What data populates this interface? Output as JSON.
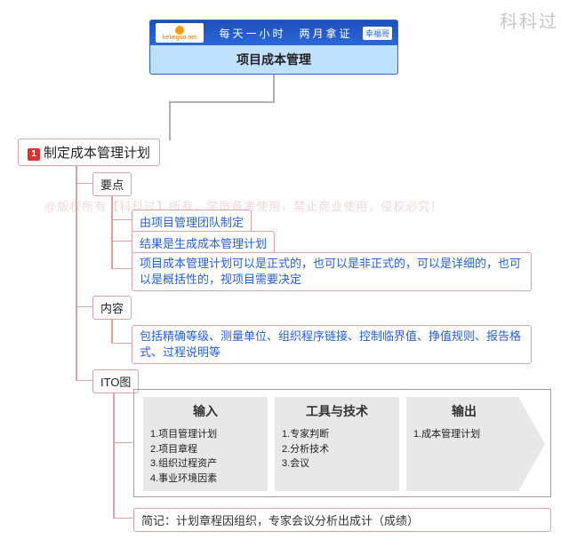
{
  "watermark": {
    "top_right": "科科过",
    "middle": "@版权所有【科科过】所有，学员备考使用，禁止商业使用，侵权必究！"
  },
  "root": {
    "brand_text": "科科过",
    "brand_url": "kekeguo.net",
    "slogan": "每天一小时　两月拿证",
    "tag": "幸福哥",
    "title": "项目成本管理"
  },
  "main_node": {
    "index": "1",
    "label": "制定成本管理计划"
  },
  "sections": {
    "keypoints": {
      "label": "要点",
      "items": [
        "由项目管理团队制定",
        "结果是生成成本管理计划",
        "项目成本管理计划可以是正式的，也可以是非正式的，可以是详细的，也可以是概括性的，视项目需要决定"
      ]
    },
    "content": {
      "label": "内容",
      "body": "包括精确等级、测量单位、组织程序链接、控制临界值、挣值规则、报告格式、过程说明等"
    },
    "ito": {
      "label": "ITO图",
      "headers": {
        "in": "输入",
        "tt": "工具与技术",
        "out": "输出"
      },
      "inputs": [
        "1.项目管理计划",
        "2.项目章程",
        "3.组织过程资产",
        "4.事业环境因素"
      ],
      "tools": [
        "1.专家判断",
        "2.分析技术",
        "3.会议"
      ],
      "outputs": [
        "1.成本管理计划"
      ],
      "mnemonic": "简记：计划章程因组织，专家会议分析出成计（成绩）"
    }
  }
}
